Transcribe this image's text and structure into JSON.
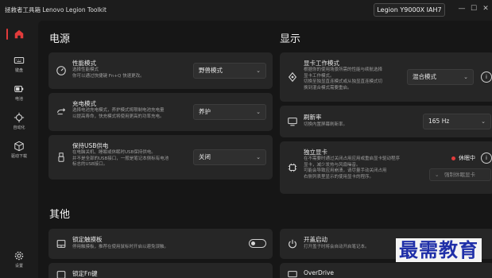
{
  "app": {
    "title": "拯救者工具箱 Lenovo Legion Toolkit",
    "model": "Legion Y9000X IAH7"
  },
  "window_controls": {
    "minimize": "—",
    "maximize": "☐",
    "close": "✕"
  },
  "sidebar": {
    "items": [
      {
        "label": "",
        "icon": "home-icon",
        "active": true
      },
      {
        "label": "键盘",
        "icon": "keyboard-icon"
      },
      {
        "label": "电池",
        "icon": "battery-icon"
      },
      {
        "label": "自动化",
        "icon": "automation-icon"
      },
      {
        "label": "驱动下载",
        "icon": "package-icon"
      },
      {
        "label": "设置",
        "icon": "gear-icon"
      }
    ]
  },
  "sections": {
    "power": "电源",
    "display": "显示",
    "other": "其他"
  },
  "power_cards": [
    {
      "title": "性能模式",
      "desc": "选择性能模式\n你可以通过快捷键 Fn+Q 快速更改。",
      "value": "野兽模式",
      "icon": "gauge-icon"
    },
    {
      "title": "充电模式",
      "desc": "选择电池充电模式，养护模式将限制电池充电量\n以提高寿命，快充模式将使用更高的功率充电。",
      "value": "养护",
      "icon": "charging-icon"
    },
    {
      "title": "保持USB供电",
      "desc": "在电脑关机、睡眠或休眠时USB保持供电。\n并不是全部的USB接口，一般是笔记本侧标有电池\n标志的USB接口。",
      "value": "关闭",
      "icon": "usb-icon"
    }
  ],
  "display_cards": [
    {
      "title": "显卡工作模式",
      "desc": "根据你的使用场景所需的性能与续航选择\n显卡工作模式。\n切换至独显直连模式或从独显直连模式切\n换到混合模式需要重启。",
      "value": "混合模式",
      "icon": "gpu-mode-icon"
    },
    {
      "title": "刷新率",
      "desc": "切换内置屏幕刷新率。",
      "value": "165 Hz",
      "icon": "monitor-icon"
    },
    {
      "title": "独立显卡",
      "desc": "在不需要时通过关闭占用应用或重启显卡驱动程序\n显卡，减少发热与风扇噪音。\n可能会导致应用崩溃，请尽量手动关闭占用\n右侧列表里显示的使用显卡的程序。",
      "status": "休眠中",
      "sub_button": "强制休眠显卡",
      "icon": "chip-icon"
    }
  ],
  "other_cards": [
    {
      "title": "锁定触摸板",
      "desc": "停用触摸板，推荐在使用鼠标时开启以避免误触。",
      "icon": "touchpad-icon",
      "toggle": false
    },
    {
      "title": "锁定Fn键",
      "desc": "",
      "icon": "fn-icon"
    },
    {
      "title": "开盖启动",
      "desc": "打开盖子时将会自动开启笔记本。",
      "icon": "power-icon"
    },
    {
      "title": "OverDrive",
      "desc": "",
      "icon": "overdrive-icon"
    }
  ],
  "watermark": "最需教育",
  "colors": {
    "accent": "#e23b3b",
    "card": "#262626",
    "background": "#161616"
  }
}
